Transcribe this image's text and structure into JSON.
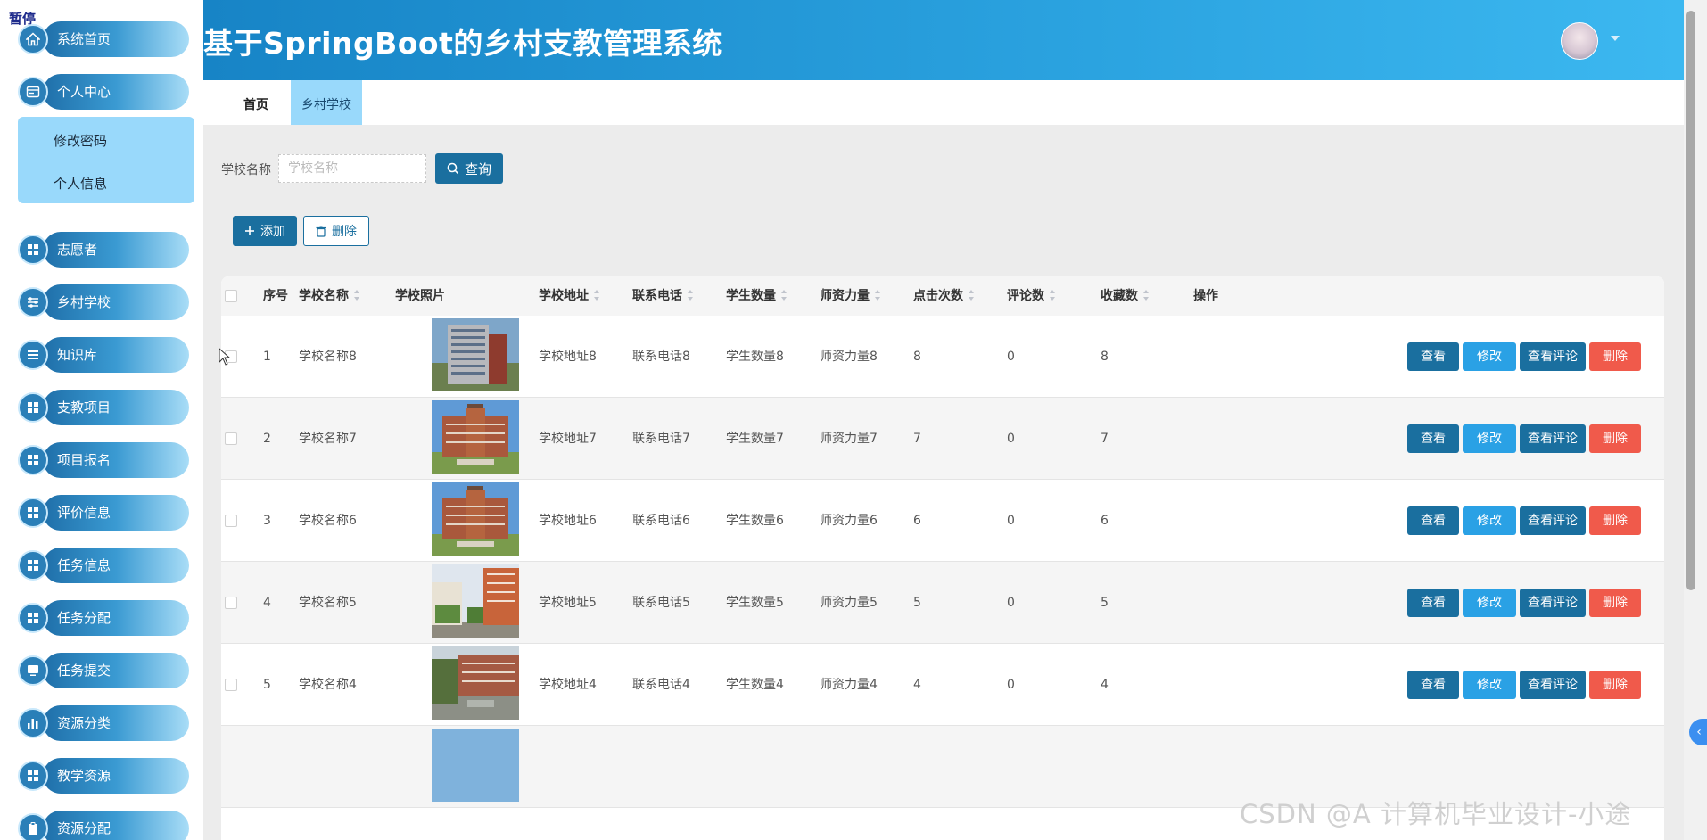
{
  "overlay": {
    "pause_label": "暂停"
  },
  "sidebar": {
    "items": [
      {
        "label": "系统首页",
        "icon": "home-icon"
      },
      {
        "label": "个人中心",
        "icon": "card-icon"
      },
      {
        "label": "志愿者",
        "icon": "grid-icon"
      },
      {
        "label": "乡村学校",
        "icon": "sliders-icon"
      },
      {
        "label": "知识库",
        "icon": "list-icon"
      },
      {
        "label": "支教项目",
        "icon": "grid-icon"
      },
      {
        "label": "项目报名",
        "icon": "grid-icon"
      },
      {
        "label": "评价信息",
        "icon": "grid-icon"
      },
      {
        "label": "任务信息",
        "icon": "grid-icon"
      },
      {
        "label": "任务分配",
        "icon": "grid-icon"
      },
      {
        "label": "任务提交",
        "icon": "monitor-icon"
      },
      {
        "label": "资源分类",
        "icon": "bar-chart-icon"
      },
      {
        "label": "教学资源",
        "icon": "grid-icon"
      },
      {
        "label": "资源分配",
        "icon": "clipboard-icon"
      }
    ],
    "submenu": [
      "修改密码",
      "个人信息"
    ]
  },
  "header": {
    "title": "基于SpringBoot的乡村支教管理系统"
  },
  "tabs": [
    "首页",
    "乡村学校"
  ],
  "search": {
    "label": "学校名称",
    "placeholder": "学校名称",
    "value": "",
    "button": "查询"
  },
  "actions": {
    "add": "添加",
    "delete": "删除"
  },
  "table": {
    "columns": [
      "序号",
      "学校名称",
      "学校照片",
      "学校地址",
      "联系电话",
      "学生数量",
      "师资力量",
      "点击次数",
      "评论数",
      "收藏数",
      "操作"
    ],
    "row_ops": {
      "view": "查看",
      "edit": "修改",
      "comments": "查看评论",
      "delete": "删除"
    },
    "rows": [
      {
        "index": "1",
        "name": "学校名称8",
        "address": "学校地址8",
        "phone": "联系电话8",
        "students": "学生数量8",
        "teachers": "师资力量8",
        "clicks": "8",
        "comments": "0",
        "favorites": "8"
      },
      {
        "index": "2",
        "name": "学校名称7",
        "address": "学校地址7",
        "phone": "联系电话7",
        "students": "学生数量7",
        "teachers": "师资力量7",
        "clicks": "7",
        "comments": "0",
        "favorites": "7"
      },
      {
        "index": "3",
        "name": "学校名称6",
        "address": "学校地址6",
        "phone": "联系电话6",
        "students": "学生数量6",
        "teachers": "师资力量6",
        "clicks": "6",
        "comments": "0",
        "favorites": "6"
      },
      {
        "index": "4",
        "name": "学校名称5",
        "address": "学校地址5",
        "phone": "联系电话5",
        "students": "学生数量5",
        "teachers": "师资力量5",
        "clicks": "5",
        "comments": "0",
        "favorites": "5"
      },
      {
        "index": "5",
        "name": "学校名称4",
        "address": "学校地址4",
        "phone": "联系电话4",
        "students": "学生数量4",
        "teachers": "师资力量4",
        "clicks": "4",
        "comments": "0",
        "favorites": "4"
      }
    ]
  },
  "watermark": "CSDN @A 计算机毕业设计-小途"
}
